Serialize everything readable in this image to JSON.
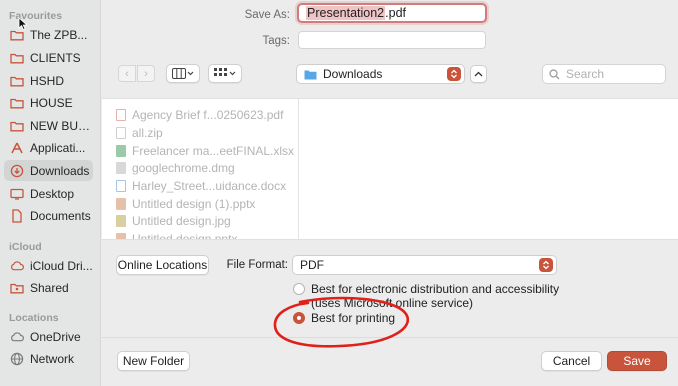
{
  "sidebar": {
    "favourites_heading": "Favourites",
    "favourites": [
      {
        "label": "The ZPB...",
        "icon": "folder-icon"
      },
      {
        "label": "CLIENTS",
        "icon": "folder-icon"
      },
      {
        "label": "HSHD",
        "icon": "folder-icon"
      },
      {
        "label": "HOUSE",
        "icon": "folder-icon"
      },
      {
        "label": "NEW BUS...",
        "icon": "folder-icon"
      },
      {
        "label": "Applicati...",
        "icon": "applications-icon"
      },
      {
        "label": "Downloads",
        "icon": "downloads-icon"
      },
      {
        "label": "Desktop",
        "icon": "desktop-icon"
      },
      {
        "label": "Documents",
        "icon": "document-icon"
      }
    ],
    "icloud_heading": "iCloud",
    "icloud": [
      {
        "label": "iCloud Dri...",
        "icon": "cloud-icon"
      },
      {
        "label": "Shared",
        "icon": "shared-folder-icon"
      }
    ],
    "locations_heading": "Locations",
    "locations": [
      {
        "label": "OneDrive",
        "icon": "cloud-icon"
      },
      {
        "label": "Network",
        "icon": "globe-icon"
      }
    ]
  },
  "save_as": {
    "label": "Save As:",
    "filename_selected": "Presentation2",
    "filename_ext": ".pdf"
  },
  "tags": {
    "label": "Tags:",
    "value": ""
  },
  "location": {
    "selected": "Downloads"
  },
  "search": {
    "placeholder": "Search"
  },
  "files": [
    {
      "name": "Agency Brief f...0250623.pdf",
      "icon": "pdf-icon"
    },
    {
      "name": "all.zip",
      "icon": "zip-icon"
    },
    {
      "name": "Freelancer ma...eetFINAL.xlsx",
      "icon": "excel-icon"
    },
    {
      "name": "googlechrome.dmg",
      "icon": "dmg-icon"
    },
    {
      "name": "Harley_Street...uidance.docx",
      "icon": "word-icon"
    },
    {
      "name": "Untitled design (1).pptx",
      "icon": "powerpoint-icon"
    },
    {
      "name": "Untitled design.jpg",
      "icon": "image-icon"
    },
    {
      "name": "Untitled design.pptx",
      "icon": "powerpoint-icon"
    }
  ],
  "online_locations_label": "Online Locations",
  "file_format": {
    "label": "File Format:",
    "selected": "PDF"
  },
  "options": [
    {
      "label": "Best for electronic distribution and accessibility",
      "sublabel": "(uses Microsoft online service)",
      "selected": false
    },
    {
      "label": "Best for printing",
      "sublabel": "",
      "selected": true
    }
  ],
  "buttons": {
    "new_folder": "New Folder",
    "cancel": "Cancel",
    "save": "Save"
  },
  "colors": {
    "accent": "#c8553b",
    "annotation": "#e0201a"
  }
}
